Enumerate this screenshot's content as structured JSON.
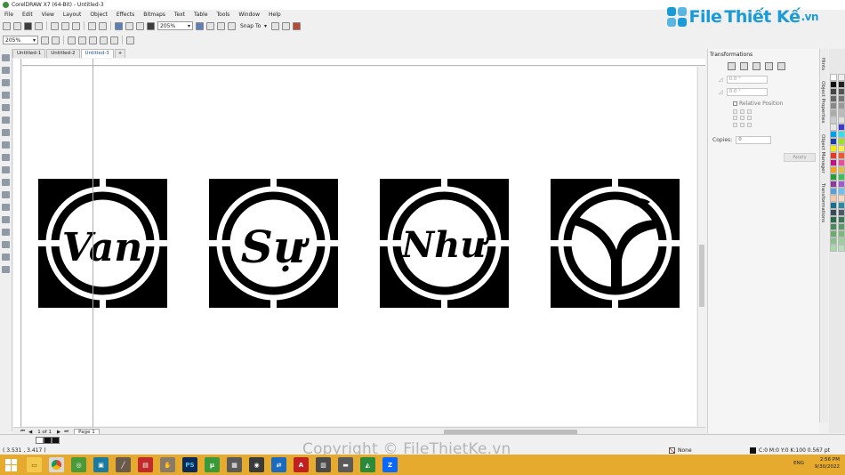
{
  "window": {
    "title": "CorelDRAW X7 (64-Bit) - Untitled-3"
  },
  "watermark": {
    "brand_file": "File",
    "brand_rest": "Thiết Kế",
    "brand_tld": ".vn",
    "copyright": "Copyright © FileThietKe.vn"
  },
  "menu": [
    "File",
    "Edit",
    "View",
    "Layout",
    "Object",
    "Effects",
    "Bitmaps",
    "Text",
    "Table",
    "Tools",
    "Window",
    "Help"
  ],
  "toolbar": {
    "zoom_value": "205%",
    "snap_to": "Snap To"
  },
  "propertybar": {
    "zoom_value": "205%"
  },
  "document_tabs": [
    "Untitled-1",
    "Untitled-2",
    "Untitled-3"
  ],
  "tiles": [
    {
      "label": "Van",
      "icon": "van-logo-icon"
    },
    {
      "label": "Sự",
      "icon": "su-logo-icon"
    },
    {
      "label": "Như",
      "icon": "nhu-logo-icon"
    },
    {
      "label": "Y",
      "icon": "y-logo-icon"
    }
  ],
  "transformations": {
    "title": "Transformations",
    "field1": "0.0 °",
    "field2": "0.0 °",
    "relative_position": "Relative Position",
    "copies_label": "Copies:",
    "copies_value": "0",
    "apply": "Apply"
  },
  "side_tabs": [
    "Hints",
    "Object Properties",
    "Object Manager",
    "Transformations"
  ],
  "page_nav": {
    "count": "1 of 1",
    "page_tab": "Page 1"
  },
  "status": {
    "coords": "( 3.531 , 3.417 )",
    "outline": "None",
    "fill": "C:0 M:0 Y:0 K:100  0.567 pt"
  },
  "clock": {
    "time": "2:56 PM",
    "date": "9/30/2022",
    "lang": "ENG"
  },
  "taskbar_apps": [
    "PS",
    "Z"
  ],
  "colors": {
    "accent": "#1a9bd8",
    "taskbar": "#e6ab2e"
  }
}
